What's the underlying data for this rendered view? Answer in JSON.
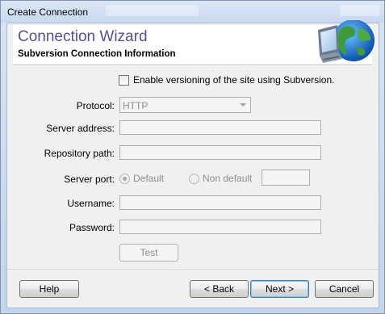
{
  "window": {
    "title": "Create Connection"
  },
  "header": {
    "title": "Connection Wizard",
    "subtitle": "Subversion Connection Information",
    "icon": "globe-computer-icon"
  },
  "form": {
    "enable_versioning_label": "Enable versioning of the site using Subversion.",
    "enable_versioning_checked": false,
    "protocol_label": "Protocol:",
    "protocol_value": "HTTP",
    "server_address_label": "Server address:",
    "server_address_value": "",
    "repository_path_label": "Repository path:",
    "repository_path_value": "",
    "server_port_label": "Server port:",
    "port_default_label": "Default",
    "port_non_default_label": "Non default",
    "port_value": "",
    "username_label": "Username:",
    "username_value": "",
    "password_label": "Password:",
    "password_value": "",
    "test_button": "Test"
  },
  "footer": {
    "help": "Help",
    "back": "< Back",
    "next": "Next >",
    "cancel": "Cancel"
  }
}
